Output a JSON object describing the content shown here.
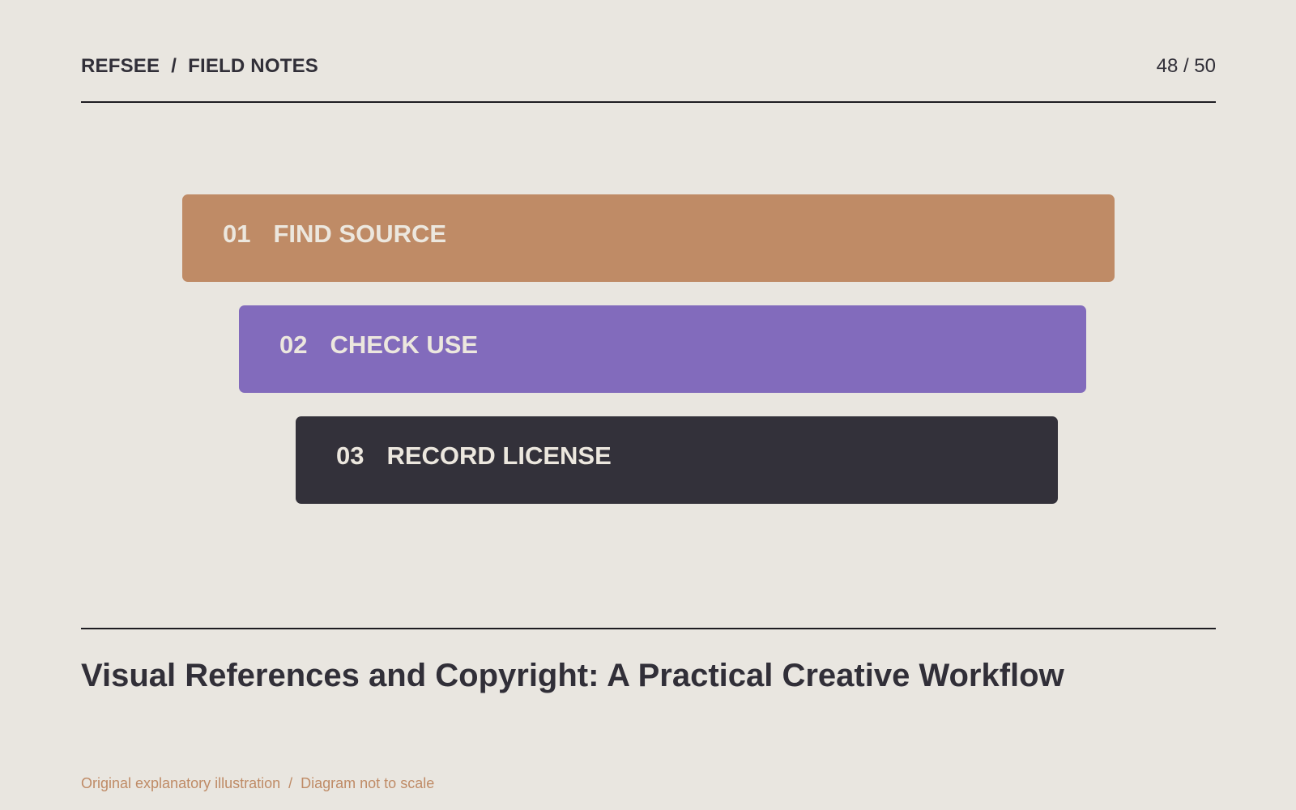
{
  "header": {
    "brand": "REFSEE",
    "separator": "/",
    "section": "FIELD NOTES",
    "page_count": "48 / 50"
  },
  "diagram": {
    "steps": [
      {
        "number": "01",
        "label": "FIND SOURCE",
        "color": "#bf8b66"
      },
      {
        "number": "02",
        "label": "CHECK USE",
        "color": "#826bbc"
      },
      {
        "number": "03",
        "label": "RECORD LICENSE",
        "color": "#33313a"
      }
    ]
  },
  "title": "Visual References and Copyright: A Practical Creative Workflow",
  "footnote": {
    "left": "Original explanatory illustration",
    "separator": "/",
    "right": "Diagram not to scale"
  },
  "colors": {
    "background": "#e9e6e0",
    "text": "#312f38",
    "accent": "#bf8b66",
    "rule": "#1e1d22"
  }
}
